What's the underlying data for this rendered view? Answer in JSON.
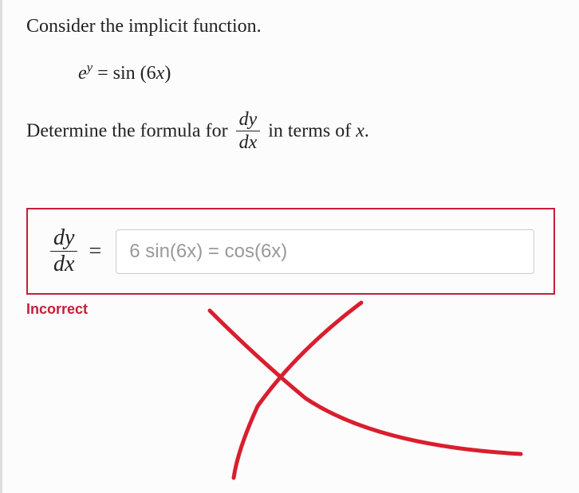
{
  "prompt1": "Consider the implicit function.",
  "equation_lhs": "e",
  "equation_sup": "y",
  "equation_eq": " = ",
  "equation_rhs": "sin (6",
  "equation_x": "x",
  "equation_close": ")",
  "prompt2_a": "Determine the formula for ",
  "frac_num": "dy",
  "frac_den": "dx",
  "prompt2_b": " in terms of ",
  "prompt2_x": "x",
  "prompt2_c": ".",
  "answer_frac_num": "dy",
  "answer_frac_den": "dx",
  "answer_eq": "=",
  "answer_value": "6 sin(6x) = cos(6x)",
  "feedback": "Incorrect"
}
